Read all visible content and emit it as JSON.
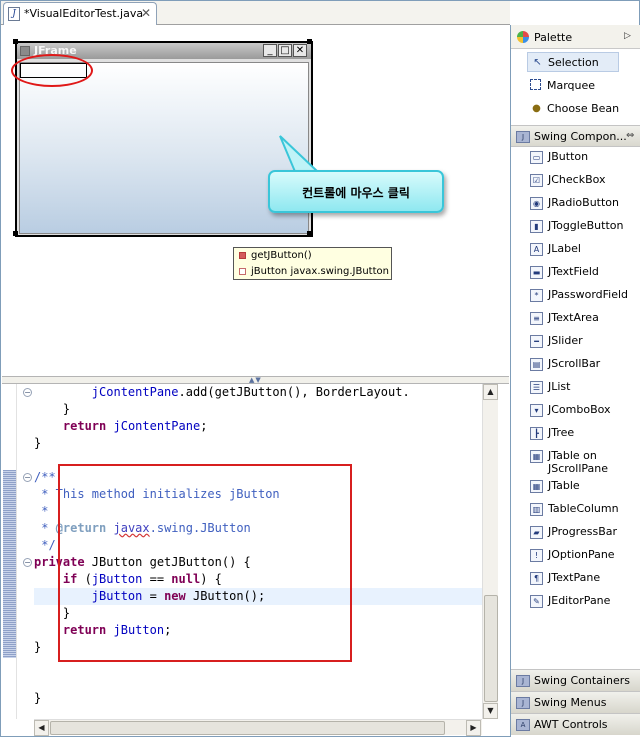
{
  "editor_tab": {
    "title": "*VisualEditorTest.java",
    "icon": "java-file-icon",
    "close": "✕"
  },
  "canvas": {
    "jframe_title": "JFrame",
    "window_buttons": [
      "_",
      "□",
      "✕"
    ],
    "callout_text": "컨트롤에 마우스 클릭",
    "popup_items": [
      "getJButton()",
      "jButton javax.swing.JButton"
    ]
  },
  "code_lines": [
    {
      "indent": "        ",
      "parts": [
        {
          "t": "jContentPane",
          "c": "fld"
        },
        {
          "t": ".add(getJButton(), BorderLayout.",
          "c": ""
        }
      ]
    },
    {
      "indent": "    ",
      "parts": [
        {
          "t": "}",
          "c": ""
        }
      ]
    },
    {
      "indent": "    ",
      "parts": [
        {
          "t": "return",
          "c": "kw"
        },
        {
          "t": " ",
          "c": ""
        },
        {
          "t": "jContentPane",
          "c": "fld"
        },
        {
          "t": ";",
          "c": ""
        }
      ]
    },
    {
      "indent": "",
      "parts": [
        {
          "t": "}",
          "c": ""
        }
      ]
    },
    {
      "indent": "",
      "parts": []
    },
    {
      "indent": "",
      "parts": [
        {
          "t": "/**",
          "c": "cmt"
        }
      ]
    },
    {
      "indent": "",
      "parts": [
        {
          "t": " * This method initializes jButton",
          "c": "cmt"
        }
      ]
    },
    {
      "indent": "",
      "parts": [
        {
          "t": " *",
          "c": "cmt"
        }
      ]
    },
    {
      "indent": "",
      "parts": [
        {
          "t": " * ",
          "c": "cmt"
        },
        {
          "t": "@return",
          "c": "tag"
        },
        {
          "t": " ",
          "c": "cmt"
        },
        {
          "t": "javax",
          "c": "ref"
        },
        {
          "t": ".swing.JButton",
          "c": "cmt"
        }
      ]
    },
    {
      "indent": "",
      "parts": [
        {
          "t": " */",
          "c": "cmt"
        }
      ]
    },
    {
      "indent": "",
      "parts": [
        {
          "t": "private",
          "c": "kw"
        },
        {
          "t": " JButton getJButton() {",
          "c": ""
        }
      ]
    },
    {
      "indent": "    ",
      "parts": [
        {
          "t": "if",
          "c": "kw"
        },
        {
          "t": " (",
          "c": ""
        },
        {
          "t": "jButton",
          "c": "fld"
        },
        {
          "t": " == ",
          "c": ""
        },
        {
          "t": "null",
          "c": "kw"
        },
        {
          "t": ") {",
          "c": ""
        }
      ]
    },
    {
      "indent": "        ",
      "parts": [
        {
          "t": "jButton",
          "c": "fld"
        },
        {
          "t": " = ",
          "c": ""
        },
        {
          "t": "new",
          "c": "kw"
        },
        {
          "t": " JButton();",
          "c": ""
        }
      ]
    },
    {
      "indent": "    ",
      "parts": [
        {
          "t": "}",
          "c": ""
        }
      ]
    },
    {
      "indent": "    ",
      "parts": [
        {
          "t": "return",
          "c": "kw"
        },
        {
          "t": " ",
          "c": ""
        },
        {
          "t": "jButton",
          "c": "fld"
        },
        {
          "t": ";",
          "c": ""
        }
      ]
    },
    {
      "indent": "",
      "parts": [
        {
          "t": "}",
          "c": ""
        }
      ]
    },
    {
      "indent": "",
      "parts": []
    },
    {
      "indent": "",
      "parts": []
    },
    {
      "indent": "",
      "parts": [
        {
          "t": "}",
          "c": ""
        }
      ]
    }
  ],
  "palette": {
    "title": "Palette",
    "tools": [
      {
        "label": "Selection",
        "icon": "arrow-pointer-icon",
        "selected": true
      },
      {
        "label": "Marquee",
        "icon": "marquee-icon",
        "selected": false
      },
      {
        "label": "Choose Bean",
        "icon": "bean-icon",
        "selected": false
      }
    ],
    "swing_components_header": "Swing Compon...",
    "swing_components": [
      {
        "label": "JButton",
        "icon": "jbutton-icon"
      },
      {
        "label": "JCheckBox",
        "icon": "jcheckbox-icon"
      },
      {
        "label": "JRadioButton",
        "icon": "jradiobutton-icon"
      },
      {
        "label": "JToggleButton",
        "icon": "jtogglebutton-icon"
      },
      {
        "label": "JLabel",
        "icon": "jlabel-icon"
      },
      {
        "label": "JTextField",
        "icon": "jtextfield-icon"
      },
      {
        "label": "JPasswordField",
        "icon": "jpasswordfield-icon"
      },
      {
        "label": "JTextArea",
        "icon": "jtextarea-icon"
      },
      {
        "label": "JSlider",
        "icon": "jslider-icon"
      },
      {
        "label": "JScrollBar",
        "icon": "jscrollbar-icon"
      },
      {
        "label": "JList",
        "icon": "jlist-icon"
      },
      {
        "label": "JComboBox",
        "icon": "jcombobox-icon"
      },
      {
        "label": "JTree",
        "icon": "jtree-icon"
      },
      {
        "label": "JTable on\nJScrollPane",
        "icon": "jtable-scrollpane-icon"
      },
      {
        "label": "JTable",
        "icon": "jtable-icon"
      },
      {
        "label": "TableColumn",
        "icon": "tablecolumn-icon"
      },
      {
        "label": "JProgressBar",
        "icon": "jprogressbar-icon"
      },
      {
        "label": "JOptionPane",
        "icon": "joptionpane-icon"
      },
      {
        "label": "JTextPane",
        "icon": "jtextpane-icon"
      },
      {
        "label": "JEditorPane",
        "icon": "jeditorpane-icon"
      }
    ],
    "drawers": [
      "Swing Containers",
      "Swing Menus",
      "AWT Controls"
    ]
  }
}
